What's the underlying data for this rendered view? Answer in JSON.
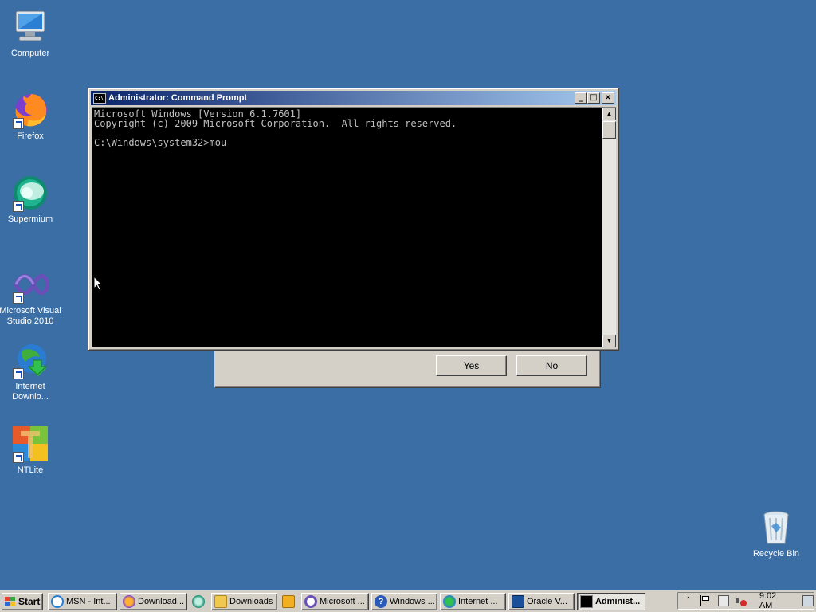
{
  "desktop": {
    "icons": [
      {
        "label": "Computer",
        "icon": "computer-icon"
      },
      {
        "label": "Firefox",
        "icon": "firefox-icon"
      },
      {
        "label": "Supermium",
        "icon": "supermium-icon"
      },
      {
        "label": "Microsoft Visual Studio 2010",
        "icon": "visual-studio-icon"
      },
      {
        "label": "Internet Downlo...",
        "icon": "internet-download-manager-icon"
      },
      {
        "label": "NTLite",
        "icon": "ntlite-icon"
      },
      {
        "label": "Recycle Bin",
        "icon": "recycle-bin-icon"
      }
    ]
  },
  "cmd_window": {
    "title": "Administrator: Command Prompt",
    "minimize": "_",
    "maximize": "□",
    "close": "×",
    "lines": [
      "Microsoft Windows [Version 6.1.7601]",
      "Copyright (c) 2009 Microsoft Corporation.  All rights reserved.",
      "",
      "C:\\Windows\\system32>mou"
    ]
  },
  "dialog": {
    "yes_label": "Yes",
    "no_label": "No"
  },
  "taskbar": {
    "start_label": "Start",
    "tasks": [
      {
        "label": "MSN - Int...",
        "icon": "ie-icon",
        "active": false
      },
      {
        "label": "Download...",
        "icon": "firefox-icon",
        "active": false
      },
      {
        "label": "",
        "icon": "supermium-icon",
        "active": false
      },
      {
        "label": "Downloads",
        "icon": "folder-icon",
        "active": false
      },
      {
        "label": "",
        "icon": "media-icon",
        "active": false
      },
      {
        "label": "Microsoft ...",
        "icon": "visual-studio-icon",
        "active": false
      },
      {
        "label": "Windows ...",
        "icon": "help-icon",
        "active": false
      },
      {
        "label": "Internet ...",
        "icon": "internet-download-manager-icon",
        "active": false
      },
      {
        "label": "Oracle V...",
        "icon": "virtualbox-icon",
        "active": false
      },
      {
        "label": "Administ...",
        "icon": "cmd-icon",
        "active": true
      }
    ],
    "clock": "9:02 AM"
  }
}
